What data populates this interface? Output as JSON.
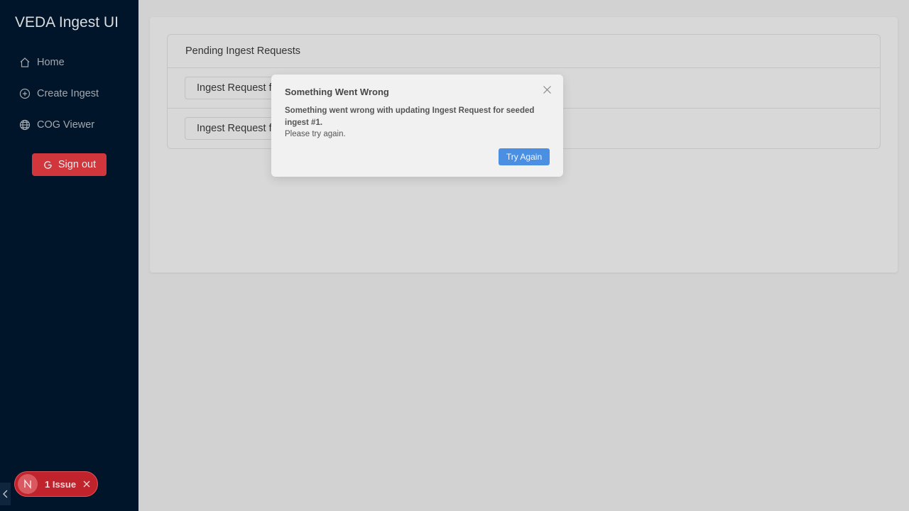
{
  "sidebar": {
    "brand": "VEDA Ingest UI",
    "items": [
      {
        "label": "Home",
        "icon": "home-icon"
      },
      {
        "label": "Create Ingest",
        "icon": "plus-circle-icon"
      },
      {
        "label": "COG Viewer",
        "icon": "globe-icon"
      }
    ],
    "sign_out_label": "Sign out"
  },
  "main": {
    "panel_title": "Pending Ingest Requests",
    "requests": [
      {
        "label": "Ingest Request for seeded ingest #1"
      },
      {
        "label": "Ingest Request for seeded ingest #2"
      }
    ]
  },
  "modal": {
    "title": "Something Went Wrong",
    "message": "Something went wrong with updating Ingest Request for seeded ingest #1.",
    "sub_message": "Please try again.",
    "button_label": "Try Again"
  },
  "dev_overlay": {
    "badge_letter": "N",
    "issues_label": "1 Issue"
  },
  "colors": {
    "sidebar_bg": "#001529",
    "sign_out_bg": "#d0363c",
    "primary_button": "#4b8fe2",
    "issue_pill": "#c0232b"
  }
}
